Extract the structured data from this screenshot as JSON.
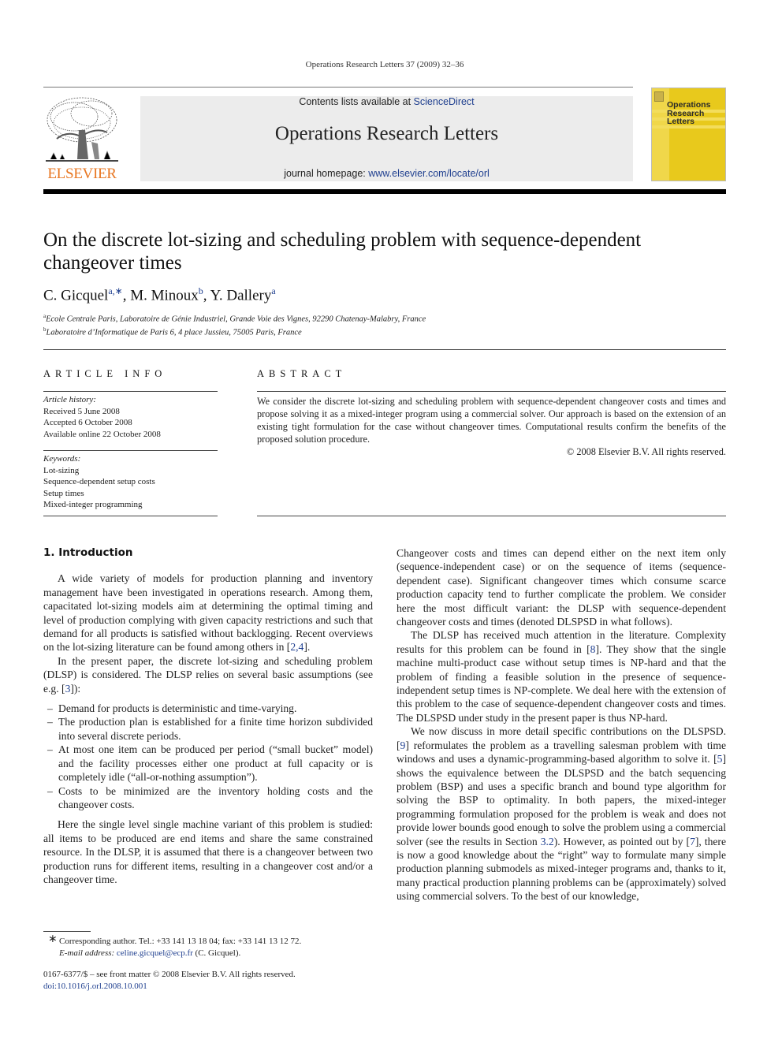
{
  "running_head": "Operations Research Letters 37 (2009) 32–36",
  "publisher": {
    "logo_text": "ELSEVIER",
    "logo_color": "#e87722"
  },
  "banner": {
    "contents_prefix": "Contents lists available at ",
    "contents_link": "ScienceDirect",
    "journal_title": "Operations Research Letters",
    "homepage_prefix": "journal homepage: ",
    "homepage_link": "www.elsevier.com/locate/orl"
  },
  "cover": {
    "title_lines": [
      "Operations",
      "Research",
      "Letters"
    ],
    "color": "#e8c91c"
  },
  "article": {
    "title": "On the discrete lot-sizing and scheduling problem with sequence-dependent changeover times",
    "authors": [
      {
        "name": "C. Gicquel",
        "marks": "a,∗"
      },
      {
        "name": "M. Minoux",
        "marks": "b"
      },
      {
        "name": "Y. Dallery",
        "marks": "a"
      }
    ],
    "affiliations": [
      {
        "mark": "a",
        "text": "Ecole Centrale Paris, Laboratoire de Génie Industriel, Grande Voie des Vignes, 92290 Chatenay-Malabry, France"
      },
      {
        "mark": "b",
        "text": "Laboratoire d’Informatique de Paris 6, 4 place Jussieu, 75005 Paris, France"
      }
    ]
  },
  "article_info": {
    "heading": "ARTICLE INFO",
    "history_label": "Article history:",
    "history": [
      "Received 5 June 2008",
      "Accepted 6 October 2008",
      "Available online 22 October 2008"
    ],
    "keywords_label": "Keywords:",
    "keywords": [
      "Lot-sizing",
      "Sequence-dependent setup costs",
      "Setup times",
      "Mixed-integer programming"
    ]
  },
  "abstract": {
    "heading": "ABSTRACT",
    "text": "We consider the discrete lot-sizing and scheduling problem with sequence-dependent changeover costs and times and propose solving it as a mixed-integer program using a commercial solver. Our approach is based on the extension of an existing tight formulation for the case without changeover times. Computational results confirm the benefits of the proposed solution procedure.",
    "copyright": "© 2008 Elsevier B.V. All rights reserved."
  },
  "body": {
    "section_heading": "1.  Introduction",
    "left": {
      "p1_a": "A wide variety of models for production planning and inventory management have been investigated in operations research. Among them, capacitated lot-sizing models aim at determining the optimal timing and level of production complying with given capacity restrictions and such that demand for all products is satisfied without backlogging. Recent overviews on the lot-sizing literature can be found among others in [",
      "p1_ref": "2,4",
      "p1_b": "].",
      "p2_a": "In the present paper, the discrete lot-sizing and scheduling problem (DLSP) is considered. The DLSP relies on several basic assumptions (see e.g. [",
      "p2_ref": "3",
      "p2_b": "]):",
      "bullets": [
        "Demand for products is deterministic and time-varying.",
        "The production plan is established for a finite time horizon subdivided into several discrete periods.",
        "At most one item can be produced per period (“small bucket” model) and the facility processes either one product at full capacity or is completely idle (“all-or-nothing assumption”).",
        "Costs to be minimized are the inventory holding costs and the changeover costs."
      ],
      "p3": "Here the single level single machine variant of this problem is studied: all items to be produced are end items and share the same constrained resource. In the DLSP, it is assumed that there is a changeover between two production runs for different items, resulting in a changeover cost and/or a changeover time."
    },
    "right": {
      "p1": "Changeover costs and times can depend either on the next item only (sequence-independent case) or on the sequence of items (sequence-dependent case). Significant changeover times which consume scarce production capacity tend to further complicate the problem. We consider here the most difficult variant: the DLSP with sequence-dependent changeover costs and times (denoted DLSPSD in what follows).",
      "p2_a": "The DLSP has received much attention in the literature. Complexity results for this problem can be found in [",
      "p2_ref": "8",
      "p2_b": "]. They show that the single machine multi-product case without setup times is NP-hard and that the problem of finding a feasible solution in the presence of sequence-independent setup times is NP-complete. We deal here with the extension of this problem to the case of sequence-dependent changeover costs and times. The DLSPSD under study in the present paper is thus NP-hard.",
      "p3_a": "We now discuss in more detail specific contributions on the DLSPSD. [",
      "p3_ref1": "9",
      "p3_b": "] reformulates the problem as a travelling salesman problem with time windows and uses a dynamic-programming-based algorithm to solve it. [",
      "p3_ref2": "5",
      "p3_c": "] shows the equivalence between the DLSPSD and the batch sequencing problem (BSP) and uses a specific branch and bound type algorithm for solving the BSP to optimality. In both papers, the mixed-integer programming formulation proposed for the problem is weak and does not provide lower bounds good enough to solve the problem using a commercial solver (see the results in Section ",
      "p3_ref3": "3.2",
      "p3_d": "). However, as pointed out by [",
      "p3_ref4": "7",
      "p3_e": "], there is now a good knowledge about the “right” way to formulate many simple production planning submodels as mixed-integer programs and, thanks to it, many practical production planning problems can be (approximately) solved using commercial solvers. To the best of our knowledge,"
    }
  },
  "footnote": {
    "mark": "∗",
    "line1": "Corresponding author. Tel.: +33 141 13 18 04; fax: +33 141 13 12 72.",
    "email_label": "E-mail address: ",
    "email": "celine.gicquel@ecp.fr",
    "email_suffix": " (C. Gicquel)."
  },
  "front_matter": {
    "issn_line": "0167-6377/$ – see front matter © 2008 Elsevier B.V. All rights reserved.",
    "doi": "doi:10.1016/j.orl.2008.10.001"
  }
}
